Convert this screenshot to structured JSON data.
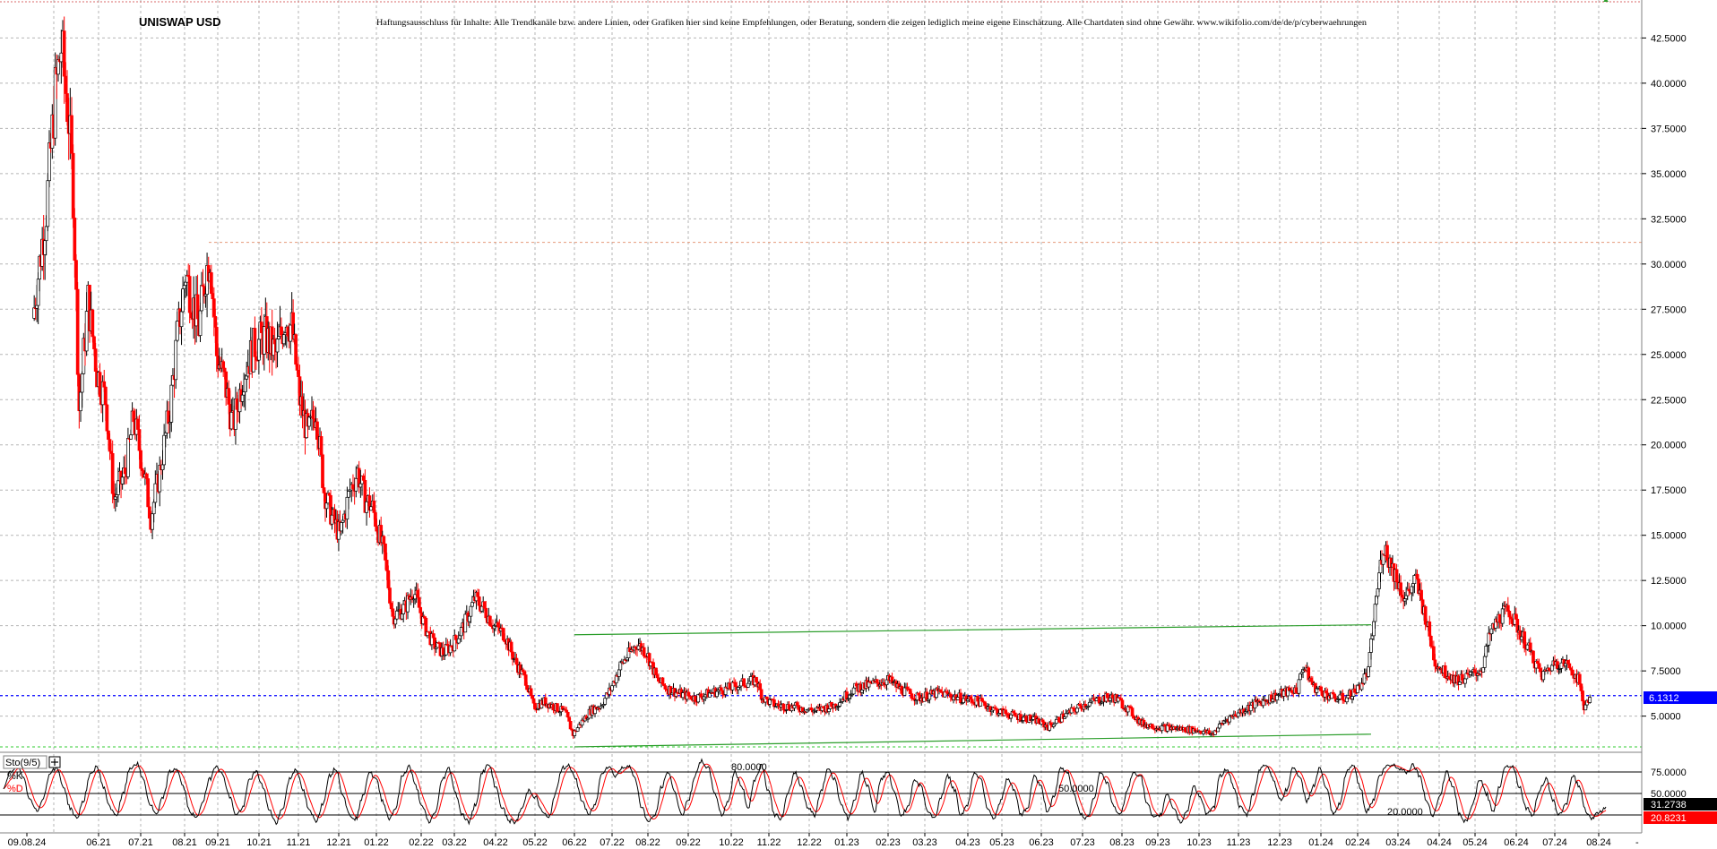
{
  "chart_data": [
    {
      "type": "candlestick",
      "title": "UNISWAP USD",
      "disclaimer": "Haftungsausschluss für Inhalte: Alle Trendkanäle bzw. andere Linien, oder Grafiken hier sind keine Empfehlungen, oder Beratung, sondern die zeigen lediglich meine eigene Einschätzung. Alle Chartdaten sind ohne Gewähr.  www.wikifolio.com/de/de/p/cyberwaehrungen",
      "yticks": [
        "5.0000",
        "7.5000",
        "10.0000",
        "12.5000",
        "15.0000",
        "17.5000",
        "20.0000",
        "22.5000",
        "25.0000",
        "27.5000",
        "30.0000",
        "32.5000",
        "35.0000",
        "37.5000",
        "40.0000",
        "42.5000"
      ],
      "ylim": [
        3.0,
        44.6
      ],
      "xticks": [
        "09.08.24",
        "06.21",
        "07.21",
        "08.21",
        "09.21",
        "10.21",
        "11.21",
        "12.21",
        "01.22",
        "02.22",
        "03.22",
        "04.22",
        "05.22",
        "06.22",
        "07.22",
        "08.22",
        "09.22",
        "10.22",
        "11.22",
        "12.22",
        "01.23",
        "02.23",
        "03.23",
        "04.23",
        "05.23",
        "06.23",
        "07.23",
        "08.23",
        "09.23",
        "10.23",
        "11.23",
        "12.23",
        "01.24",
        "02.24",
        "03.24",
        "04.24",
        "05.24",
        "06.24",
        "07.24",
        "08.24"
      ],
      "x_range": [
        "2021-05",
        "2024-08"
      ],
      "current_price": "6.1312",
      "current_price_value": 6.1312,
      "close_path": [
        {
          "x": "2021-05-01",
          "y": 27.0
        },
        {
          "x": "2021-05-10",
          "y": 33.0
        },
        {
          "x": "2021-05-16",
          "y": 39.5
        },
        {
          "x": "2021-05-20",
          "y": 42.0
        },
        {
          "x": "2021-05-25",
          "y": 38.0
        },
        {
          "x": "2021-05-28",
          "y": 34.0
        },
        {
          "x": "2021-06-02",
          "y": 22.0
        },
        {
          "x": "2021-06-08",
          "y": 28.0
        },
        {
          "x": "2021-06-14",
          "y": 24.0
        },
        {
          "x": "2021-06-20",
          "y": 22.5
        },
        {
          "x": "2021-06-26",
          "y": 17.0
        },
        {
          "x": "2021-07-04",
          "y": 18.5
        },
        {
          "x": "2021-07-10",
          "y": 21.5
        },
        {
          "x": "2021-07-16",
          "y": 19.0
        },
        {
          "x": "2021-07-22",
          "y": 16.0
        },
        {
          "x": "2021-07-28",
          "y": 18.5
        },
        {
          "x": "2021-08-05",
          "y": 22.0
        },
        {
          "x": "2021-08-10",
          "y": 26.0
        },
        {
          "x": "2021-08-16",
          "y": 29.5
        },
        {
          "x": "2021-08-22",
          "y": 28.0
        },
        {
          "x": "2021-08-28",
          "y": 26.5
        },
        {
          "x": "2021-09-04",
          "y": 29.5
        },
        {
          "x": "2021-09-08",
          "y": 30.5
        },
        {
          "x": "2021-09-14",
          "y": 25.0
        },
        {
          "x": "2021-09-20",
          "y": 23.5
        },
        {
          "x": "2021-09-26",
          "y": 21.0
        },
        {
          "x": "2021-10-04",
          "y": 24.0
        },
        {
          "x": "2021-10-12",
          "y": 25.5
        },
        {
          "x": "2021-10-20",
          "y": 26.0
        },
        {
          "x": "2021-10-28",
          "y": 25.0
        },
        {
          "x": "2021-11-05",
          "y": 27.0
        },
        {
          "x": "2021-11-10",
          "y": 26.5
        },
        {
          "x": "2021-11-16",
          "y": 22.5
        },
        {
          "x": "2021-11-22",
          "y": 20.5
        },
        {
          "x": "2021-11-28",
          "y": 22.0
        },
        {
          "x": "2021-12-04",
          "y": 17.5
        },
        {
          "x": "2021-12-10",
          "y": 16.0
        },
        {
          "x": "2021-12-16",
          "y": 15.0
        },
        {
          "x": "2021-12-24",
          "y": 17.5
        },
        {
          "x": "2021-12-30",
          "y": 18.5
        },
        {
          "x": "2022-01-06",
          "y": 17.0
        },
        {
          "x": "2022-01-12",
          "y": 16.5
        },
        {
          "x": "2022-01-20",
          "y": 14.0
        },
        {
          "x": "2022-01-26",
          "y": 10.5
        },
        {
          "x": "2022-02-04",
          "y": 11.0
        },
        {
          "x": "2022-02-10",
          "y": 12.0
        },
        {
          "x": "2022-02-18",
          "y": 10.0
        },
        {
          "x": "2022-02-26",
          "y": 9.0
        },
        {
          "x": "2022-03-05",
          "y": 8.5
        },
        {
          "x": "2022-03-14",
          "y": 9.0
        },
        {
          "x": "2022-03-22",
          "y": 10.0
        },
        {
          "x": "2022-03-30",
          "y": 11.5
        },
        {
          "x": "2022-04-06",
          "y": 11.0
        },
        {
          "x": "2022-04-14",
          "y": 10.0
        },
        {
          "x": "2022-04-22",
          "y": 9.5
        },
        {
          "x": "2022-04-30",
          "y": 8.0
        },
        {
          "x": "2022-05-08",
          "y": 7.0
        },
        {
          "x": "2022-05-14",
          "y": 5.5
        },
        {
          "x": "2022-05-22",
          "y": 5.8
        },
        {
          "x": "2022-05-30",
          "y": 5.5
        },
        {
          "x": "2022-06-08",
          "y": 5.2
        },
        {
          "x": "2022-06-14",
          "y": 4.0
        },
        {
          "x": "2022-06-20",
          "y": 4.6
        },
        {
          "x": "2022-06-28",
          "y": 5.3
        },
        {
          "x": "2022-07-06",
          "y": 5.6
        },
        {
          "x": "2022-07-14",
          "y": 6.5
        },
        {
          "x": "2022-07-22",
          "y": 7.8
        },
        {
          "x": "2022-07-30",
          "y": 8.5
        },
        {
          "x": "2022-08-06",
          "y": 9.0
        },
        {
          "x": "2022-08-14",
          "y": 8.5
        },
        {
          "x": "2022-08-22",
          "y": 7.0
        },
        {
          "x": "2022-08-30",
          "y": 6.5
        },
        {
          "x": "2022-09-10",
          "y": 6.2
        },
        {
          "x": "2022-09-20",
          "y": 6.0
        },
        {
          "x": "2022-10-01",
          "y": 6.3
        },
        {
          "x": "2022-10-12",
          "y": 6.5
        },
        {
          "x": "2022-10-24",
          "y": 6.8
        },
        {
          "x": "2022-11-05",
          "y": 7.0
        },
        {
          "x": "2022-11-10",
          "y": 6.0
        },
        {
          "x": "2022-11-20",
          "y": 5.6
        },
        {
          "x": "2022-12-05",
          "y": 5.5
        },
        {
          "x": "2022-12-20",
          "y": 5.3
        },
        {
          "x": "2023-01-05",
          "y": 5.6
        },
        {
          "x": "2023-01-20",
          "y": 6.5
        },
        {
          "x": "2023-02-05",
          "y": 6.8
        },
        {
          "x": "2023-02-15",
          "y": 7.0
        },
        {
          "x": "2023-02-25",
          "y": 6.5
        },
        {
          "x": "2023-03-10",
          "y": 6.0
        },
        {
          "x": "2023-03-25",
          "y": 6.3
        },
        {
          "x": "2023-04-10",
          "y": 6.0
        },
        {
          "x": "2023-04-25",
          "y": 5.8
        },
        {
          "x": "2023-05-10",
          "y": 5.3
        },
        {
          "x": "2023-05-25",
          "y": 5.0
        },
        {
          "x": "2023-06-10",
          "y": 4.8
        },
        {
          "x": "2023-06-20",
          "y": 4.4
        },
        {
          "x": "2023-07-01",
          "y": 5.0
        },
        {
          "x": "2023-07-15",
          "y": 5.6
        },
        {
          "x": "2023-08-01",
          "y": 6.0
        },
        {
          "x": "2023-08-10",
          "y": 6.0
        },
        {
          "x": "2023-08-20",
          "y": 5.4
        },
        {
          "x": "2023-09-01",
          "y": 4.6
        },
        {
          "x": "2023-09-15",
          "y": 4.4
        },
        {
          "x": "2023-10-01",
          "y": 4.3
        },
        {
          "x": "2023-10-15",
          "y": 4.2
        },
        {
          "x": "2023-10-25",
          "y": 4.0
        },
        {
          "x": "2023-11-05",
          "y": 4.8
        },
        {
          "x": "2023-11-20",
          "y": 5.4
        },
        {
          "x": "2023-12-01",
          "y": 5.8
        },
        {
          "x": "2023-12-15",
          "y": 6.2
        },
        {
          "x": "2023-12-28",
          "y": 6.5
        },
        {
          "x": "2024-01-02",
          "y": 7.8
        },
        {
          "x": "2024-01-10",
          "y": 6.6
        },
        {
          "x": "2024-01-25",
          "y": 6.0
        },
        {
          "x": "2024-02-05",
          "y": 6.0
        },
        {
          "x": "2024-02-15",
          "y": 6.5
        },
        {
          "x": "2024-02-23",
          "y": 7.5
        },
        {
          "x": "2024-02-28",
          "y": 11.0
        },
        {
          "x": "2024-03-04",
          "y": 14.5
        },
        {
          "x": "2024-03-12",
          "y": 13.0
        },
        {
          "x": "2024-03-20",
          "y": 11.5
        },
        {
          "x": "2024-03-28",
          "y": 12.5
        },
        {
          "x": "2024-04-05",
          "y": 10.5
        },
        {
          "x": "2024-04-12",
          "y": 8.0
        },
        {
          "x": "2024-04-20",
          "y": 7.4
        },
        {
          "x": "2024-04-30",
          "y": 7.0
        },
        {
          "x": "2024-05-10",
          "y": 7.2
        },
        {
          "x": "2024-05-20",
          "y": 7.6
        },
        {
          "x": "2024-05-26",
          "y": 9.5
        },
        {
          "x": "2024-06-03",
          "y": 10.5
        },
        {
          "x": "2024-06-10",
          "y": 10.8
        },
        {
          "x": "2024-06-18",
          "y": 9.6
        },
        {
          "x": "2024-06-26",
          "y": 8.5
        },
        {
          "x": "2024-07-05",
          "y": 7.2
        },
        {
          "x": "2024-07-15",
          "y": 8.0
        },
        {
          "x": "2024-07-25",
          "y": 7.8
        },
        {
          "x": "2024-08-01",
          "y": 7.0
        },
        {
          "x": "2024-08-05",
          "y": 5.5
        },
        {
          "x": "2024-08-09",
          "y": 6.1312
        }
      ],
      "annotations": [
        {
          "kind": "horizontal-line",
          "style": "dotted",
          "color": "#e69a7a",
          "value": 31.2,
          "from": "2021-09"
        },
        {
          "kind": "horizontal-line",
          "style": "dotted",
          "color": "#0000ff",
          "value": 6.1312
        },
        {
          "kind": "horizontal-line",
          "style": "dotted",
          "color": "#33cc33",
          "value": 3.3
        },
        {
          "kind": "trendline",
          "color": "#2a9d2a",
          "from": {
            "x": "2022-06-15",
            "y": 9.5
          },
          "to": {
            "x": "2024-02-25",
            "y": 10.05
          }
        },
        {
          "kind": "trendline",
          "color": "#2a9d2a",
          "from": {
            "x": "2022-06-15",
            "y": 3.3
          },
          "to": {
            "x": "2024-02-25",
            "y": 4.0
          }
        }
      ],
      "colors": {
        "up": "#000000",
        "down": "#ff0000",
        "grid": "#b0b0b0",
        "price_tag": "#0000ff"
      }
    },
    {
      "type": "line",
      "title": "Sto(9/5)",
      "series": [
        {
          "name": "%K",
          "color": "#000000"
        },
        {
          "name": "%D",
          "color": "#ff0000"
        }
      ],
      "yticks": [
        "75.0000",
        "50.0000"
      ],
      "levels": [
        "80.0000",
        "50.0000",
        "20.0000"
      ],
      "ylim": [
        0,
        100
      ],
      "k_last": "31.2738",
      "d_last": "20.8231",
      "k_path": [
        {
          "x": "2021-05",
          "y": [
            55,
            80,
            90,
            70,
            40,
            25,
            45,
            80,
            85,
            60,
            30,
            15,
            40,
            75,
            88,
            60,
            30,
            20,
            50
          ]
        },
        {
          "x": "2021-08",
          "y": [
            85,
            92,
            70,
            35,
            20,
            45,
            80,
            85,
            60,
            25,
            15,
            40,
            70,
            90,
            75,
            45,
            20,
            30,
            70
          ]
        },
        {
          "x": "2021-11",
          "y": [
            80,
            60,
            25,
            10,
            30,
            70,
            85,
            55,
            25,
            12,
            35,
            75,
            85,
            50,
            20,
            15,
            45,
            80,
            70
          ]
        },
        {
          "x": "2022-02",
          "y": [
            40,
            15,
            30,
            75,
            88,
            60,
            30,
            10,
            25,
            70,
            85,
            50,
            20,
            10,
            35,
            80,
            90,
            60
          ]
        },
        {
          "x": "2022-05",
          "y": [
            30,
            12,
            10,
            30,
            55,
            45,
            25,
            15,
            50,
            85,
            90,
            70,
            40,
            20,
            35,
            80,
            88,
            75
          ]
        },
        {
          "x": "2022-08",
          "y": [
            85,
            90,
            70,
            30,
            10,
            20,
            60,
            80,
            50,
            20,
            40,
            75,
            95,
            85,
            50,
            20,
            40,
            80,
            60
          ]
        },
        {
          "x": "2022-11",
          "y": [
            30,
            70,
            90,
            55,
            20,
            15,
            50,
            80,
            60,
            30,
            20,
            55,
            85,
            70,
            35,
            15,
            40,
            80,
            60,
            25
          ]
        },
        {
          "x": "2023-02",
          "y": [
            70,
            80,
            50,
            20,
            30,
            70,
            60,
            25,
            15,
            45,
            75,
            55,
            20,
            35,
            80,
            70,
            30,
            15,
            40
          ]
        },
        {
          "x": "2023-05",
          "y": [
            70,
            55,
            20,
            30,
            75,
            60,
            25,
            45,
            85,
            80,
            50,
            20,
            15,
            45,
            80,
            65,
            30,
            20,
            55
          ]
        },
        {
          "x": "2023-08",
          "y": [
            80,
            75,
            35,
            15,
            20,
            50,
            30,
            10,
            25,
            60,
            45,
            20,
            30,
            75,
            85,
            60,
            30,
            20,
            50
          ]
        },
        {
          "x": "2023-11",
          "y": [
            85,
            90,
            70,
            40,
            55,
            88,
            70,
            40,
            60,
            85,
            55,
            20,
            35,
            80,
            90,
            60,
            25,
            40,
            75
          ]
        },
        {
          "x": "2024-02",
          "y": [
            88,
            90,
            85,
            80,
            90,
            75,
            40,
            20,
            45,
            80,
            60,
            20,
            10,
            35,
            70,
            50,
            25,
            60,
            90
          ]
        },
        {
          "x": "2024-06",
          "y": [
            88,
            60,
            30,
            20,
            55,
            70,
            40,
            20,
            35,
            75,
            60,
            25,
            15,
            25,
            31.27
          ]
        }
      ]
    }
  ]
}
